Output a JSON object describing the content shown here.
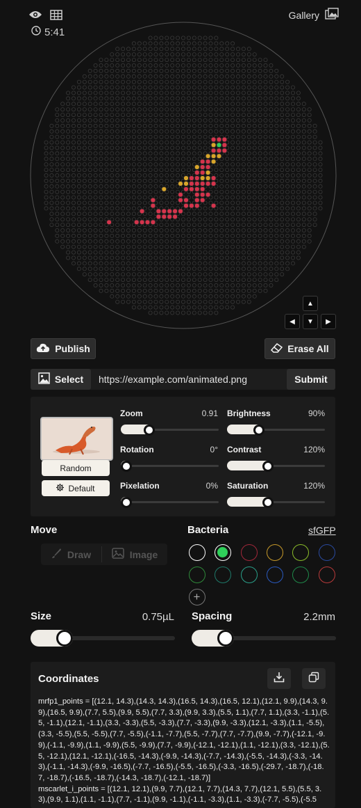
{
  "topbar": {
    "gallery_label": "Gallery",
    "timer": "5:41"
  },
  "dish": {
    "grid_color": "#3a3a3a",
    "rim_color": "#555555",
    "colors": {
      "red": "#d4344c",
      "yellow": "#d8a52a",
      "green": "#2fd05a"
    }
  },
  "toolbar": {
    "publish_label": "Publish",
    "erase_label": "Erase All"
  },
  "url_row": {
    "select_label": "Select",
    "url_value": "https://example.com/animated.png",
    "submit_label": "Submit"
  },
  "image_panel": {
    "random_label": "Random",
    "default_label": "Default",
    "sliders": [
      {
        "label": "Zoom",
        "value": "0.91",
        "fraction": 0.26
      },
      {
        "label": "Brightness",
        "value": "90%",
        "fraction": 0.3
      },
      {
        "label": "Rotation",
        "value": "0°",
        "fraction": 0.0
      },
      {
        "label": "Contrast",
        "value": "120%",
        "fraction": 0.4
      },
      {
        "label": "Pixelation",
        "value": "0%",
        "fraction": 0.0
      },
      {
        "label": "Saturation",
        "value": "120%",
        "fraction": 0.4
      }
    ]
  },
  "move": {
    "title": "Move",
    "draw_label": "Draw",
    "image_label": "Image"
  },
  "bacteria": {
    "title": "Bacteria",
    "selected_name": "sfGFP",
    "swatches": [
      "#ffffff",
      "#2fd05a",
      "#a3283a",
      "#c89a2a",
      "#8bbd2a",
      "#2a4aa0",
      "#2f8a3a",
      "#1f7a6a",
      "#2aa08a",
      "#2a5ac0",
      "#1f8a4a",
      "#b83a3a",
      "#888888"
    ],
    "selected_index": 1
  },
  "size": {
    "label": "Size",
    "value": "0.75µL",
    "fraction": 0.2
  },
  "spacing": {
    "label": "Spacing",
    "value": "2.2mm",
    "fraction": 0.2
  },
  "coordinates": {
    "title": "Coordinates",
    "text": "mrfp1_points = [(12.1, 14.3),(14.3, 14.3),(16.5, 14.3),(16.5, 12.1),(12.1, 9.9),(14.3, 9.9),(16.5, 9.9),(7.7, 5.5),(9.9, 5.5),(7.7, 3.3),(9.9, 3.3),(5.5, 1.1),(7.7, 1.1),(3.3, -1.1),(5.5, -1.1),(12.1, -1.1),(3.3, -3.3),(5.5, -3.3),(7.7, -3.3),(9.9, -3.3),(12.1, -3.3),(1.1, -5.5),(3.3, -5.5),(5.5, -5.5),(7.7, -5.5),(-1.1, -7.7),(5.5, -7.7),(7.7, -7.7),(9.9, -7.7),(-12.1, -9.9),(-1.1, -9.9),(1.1, -9.9),(5.5, -9.9),(7.7, -9.9),(-12.1, -12.1),(1.1, -12.1),(3.3, -12.1),(5.5, -12.1),(12.1, -12.1),(-16.5, -14.3),(-9.9, -14.3),(-7.7, -14.3),(-5.5, -14.3),(-3.3, -14.3),(-1.1, -14.3),(-9.9, -16.5),(-7.7, -16.5),(-5.5, -16.5),(-3.3, -16.5),(-29.7, -18.7),(-18.7, -18.7),(-16.5, -18.7),(-14.3, -18.7),(-12.1, -18.7)]",
    "text2": "mscarlet_i_points = [(12.1, 12.1),(9.9, 7.7),(12.1, 7.7),(14.3, 7.7),(12.1, 5.5),(5.5, 3.3),(9.9, 1.1),(1.1, -1.1),(7.7, -1.1),(9.9, -1.1),(-1.1, -3.3),(1.1, -3.3),(-7.7, -5.5),(-5.5"
  }
}
